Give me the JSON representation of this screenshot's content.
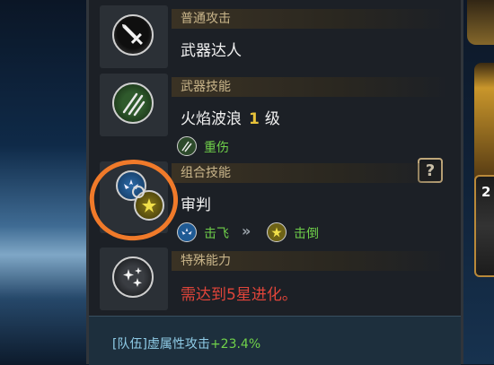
{
  "panel": {
    "sections": [
      {
        "header": "普通攻击",
        "title": "武器达人",
        "icon": "sword-icon"
      },
      {
        "header": "武器技能",
        "title": "火焰波浪",
        "level_num": "1",
        "level_unit": "级",
        "icon": "claw-slash-icon",
        "effect": {
          "label": "重伤",
          "icon": "claw-slash-icon"
        }
      },
      {
        "header": "组合技能",
        "title": "审判",
        "icon": "combo-icon",
        "effects": [
          {
            "label": "击飞",
            "icon": "blue-wing-icon"
          },
          {
            "label": "击倒",
            "icon": "gold-star-icon"
          }
        ],
        "arrow": "»"
      },
      {
        "header": "特殊能力",
        "title": "需达到5星进化。",
        "icon": "sparkle-icon"
      }
    ],
    "help_label": "?",
    "bottom": {
      "prefix": "[队伍]虚属性攻击",
      "value": "+23.4%"
    }
  },
  "side": {
    "badge": "2"
  },
  "colors": {
    "highlight_ring": "#f07a2a",
    "level": "#e8c33a",
    "red_text": "#e0453a",
    "green_text": "#6fd04a"
  }
}
